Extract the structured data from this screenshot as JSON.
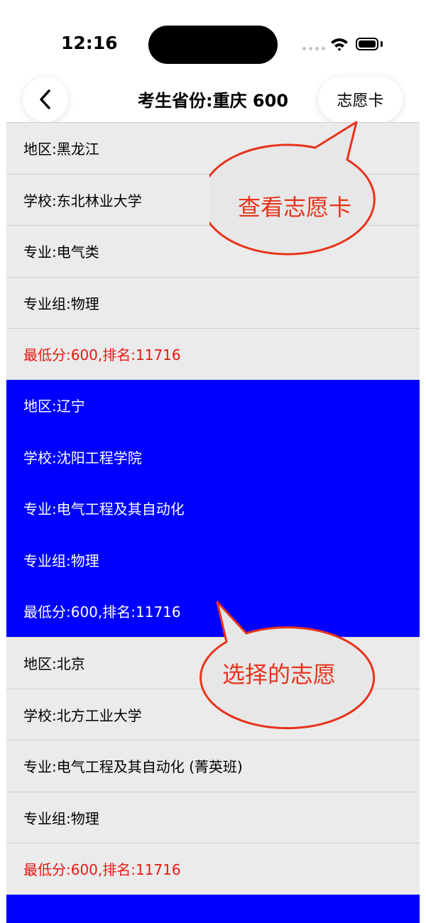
{
  "status_bar": {
    "time": "12:16"
  },
  "nav": {
    "title": "考生省份:重庆 600",
    "card_button": "志愿卡"
  },
  "groups": [
    {
      "region": "地区:黑龙江",
      "school": "学校:东北林业大学",
      "major": "专业:电气类",
      "major_group": "专业组:物理",
      "score": "最低分:600,排名:11716",
      "selected": false
    },
    {
      "region": "地区:辽宁",
      "school": "学校:沈阳工程学院",
      "major": "专业:电气工程及其自动化",
      "major_group": "专业组:物理",
      "score": "最低分:600,排名:11716",
      "selected": true
    },
    {
      "region": "地区:北京",
      "school": "学校:北方工业大学",
      "major": "专业:电气工程及其自动化 (菁英班)",
      "major_group": "专业组:物理",
      "score": "最低分:600,排名:11716",
      "selected": false
    }
  ],
  "annotations": {
    "view_card": "查看志愿卡",
    "selected_choice": "选择的志愿"
  },
  "colors": {
    "selected_bg": "#0000ff",
    "score_red": "#e8180f",
    "callout_red": "#e8331c"
  }
}
